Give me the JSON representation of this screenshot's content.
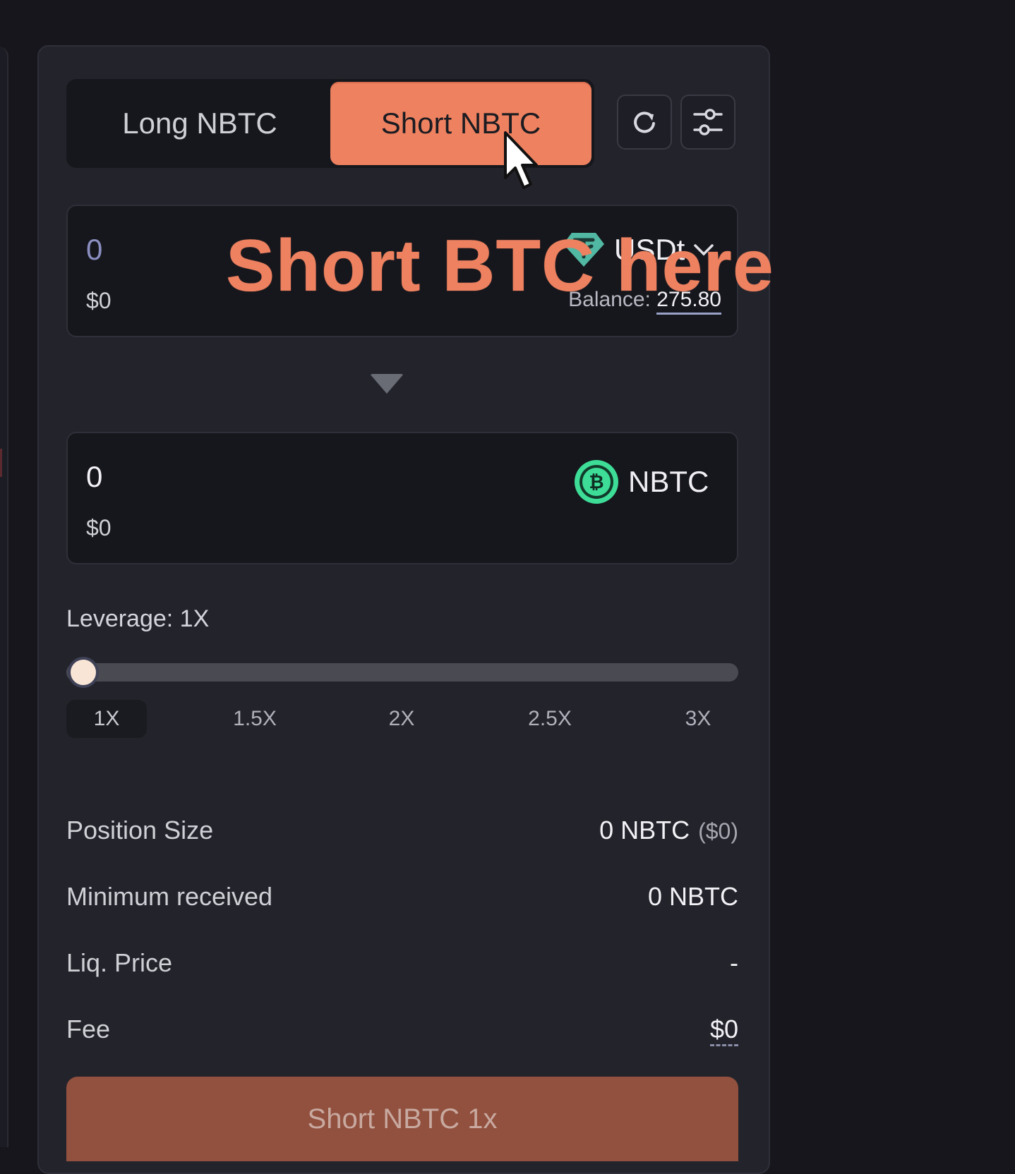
{
  "tabs": {
    "long_label": "Long NBTC",
    "short_label": "Short NBTC",
    "active": "short"
  },
  "icons": {
    "refresh": "refresh-icon",
    "settings": "sliders-icon"
  },
  "pay": {
    "amount": "0",
    "usd_value": "$0",
    "token": "USDt",
    "token_icon": "tether-icon",
    "balance_label": "Balance:",
    "balance_value": "275.80"
  },
  "overlay": {
    "text": "Short BTC here"
  },
  "receive": {
    "amount": "0",
    "usd_value": "$0",
    "token": "NBTC",
    "token_icon": "bitcoin-icon"
  },
  "leverage": {
    "label": "Leverage: 1X",
    "current": 1,
    "min": 1,
    "max": 3,
    "ticks": [
      "1X",
      "1.5X",
      "2X",
      "2.5X",
      "3X"
    ]
  },
  "details": {
    "position_size_label": "Position Size",
    "position_size_value": "0 NBTC",
    "position_size_usd": "($0)",
    "min_received_label": "Minimum received",
    "min_received_value": "0 NBTC",
    "liq_price_label": "Liq. Price",
    "liq_price_value": "-",
    "fee_label": "Fee",
    "fee_value": "$0"
  },
  "cta": {
    "label": "Short NBTC 1x"
  },
  "colors": {
    "accent": "#ee8260",
    "cta": "#92503f",
    "panel": "#23232c",
    "input_bg": "#16161d",
    "tether": "#50b8a3",
    "bitcoin_green": "#3ddc97"
  }
}
